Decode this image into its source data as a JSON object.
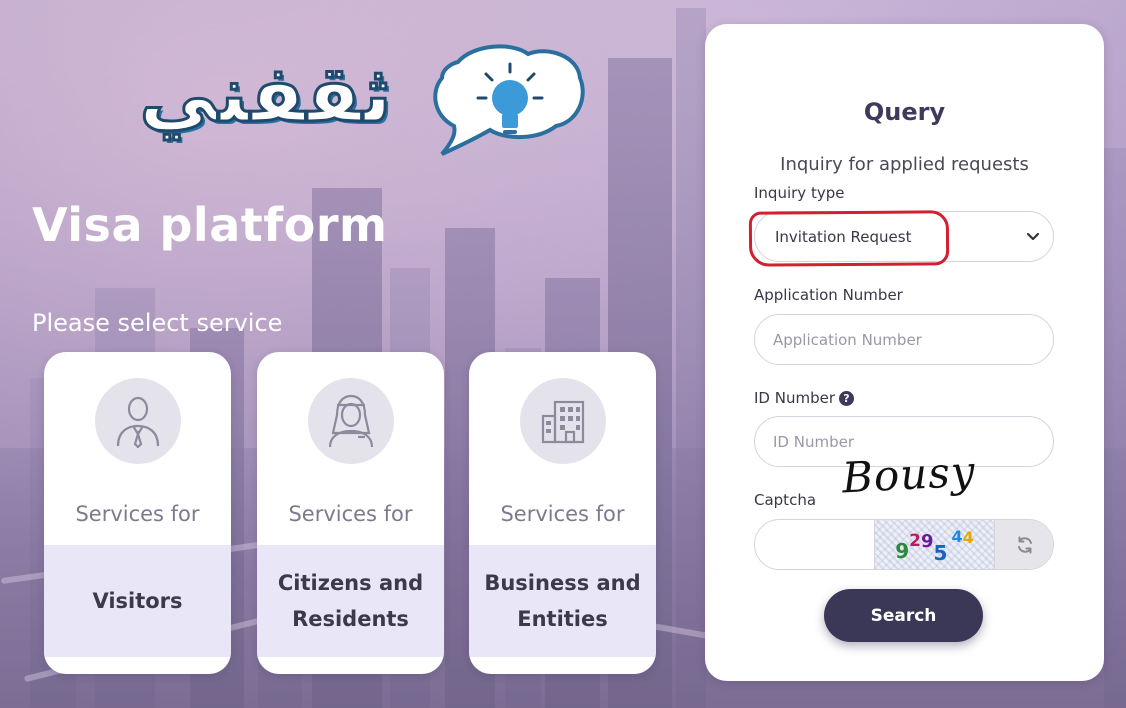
{
  "logo": {
    "text": "ثقفني",
    "icon": "lightbulb-speech-bubble-icon"
  },
  "platform": {
    "title": "Visa platform",
    "select_prompt": "Please select service"
  },
  "services": [
    {
      "pre": "Services for",
      "name": "Visitors",
      "icon": "person-tie-icon"
    },
    {
      "pre": "Services for",
      "name": "Citizens and Residents",
      "icon": "person-headdress-icon"
    },
    {
      "pre": "Services for",
      "name": "Business and Entities",
      "icon": "building-icon"
    }
  ],
  "query": {
    "title": "Query",
    "subtitle": "Inquiry for applied requests",
    "inquiry_type_label": "Inquiry type",
    "inquiry_type_value": "Invitation Request",
    "application_number_label": "Application Number",
    "application_number_placeholder": "Application Number",
    "id_number_label": "ID Number",
    "id_number_placeholder": "ID Number",
    "captcha_label": "Captcha",
    "captcha_chars": [
      "9",
      "2",
      "9",
      "5",
      "4",
      "4"
    ],
    "search_label": "Search"
  },
  "watermark": "Bousy",
  "colors": {
    "accent": "#3b3757",
    "card_band": "#e9e6f8",
    "annotation": "#d22030",
    "logo_blue": "#2a6f9e"
  }
}
